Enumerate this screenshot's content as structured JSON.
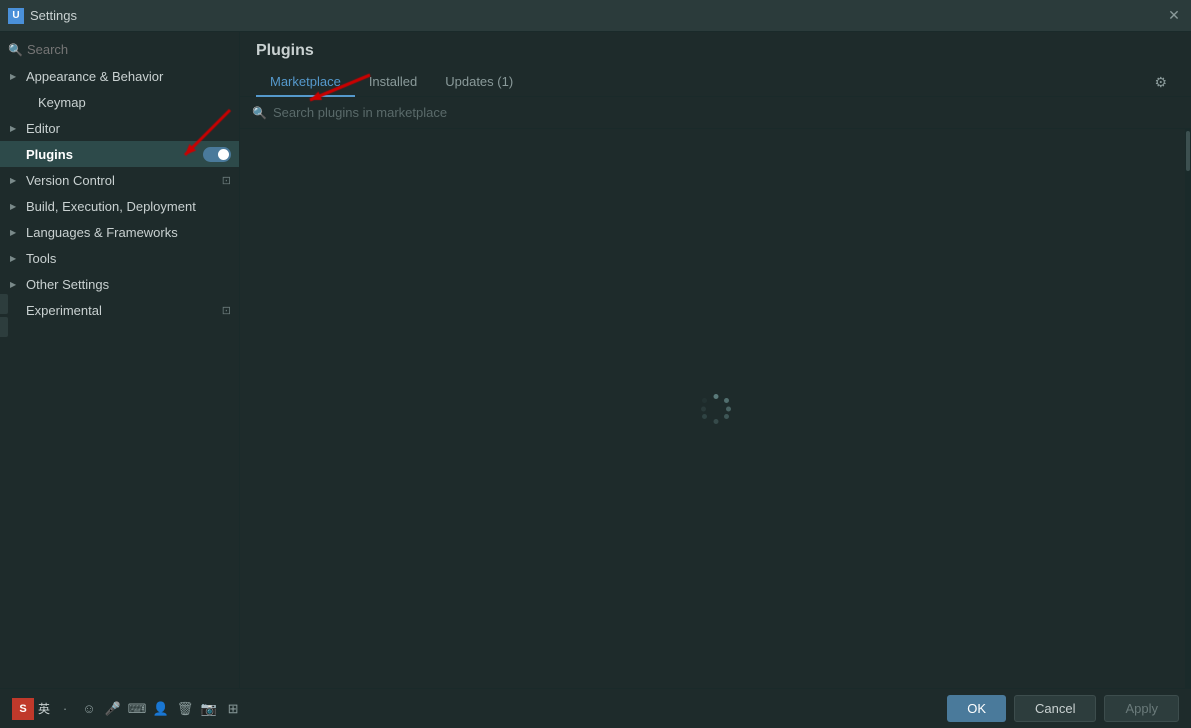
{
  "window": {
    "title": "Settings",
    "close_label": "✕"
  },
  "sidebar": {
    "search_placeholder": "Search",
    "items": [
      {
        "id": "appearance",
        "label": "Appearance & Behavior",
        "has_arrow": true,
        "indent": false,
        "active": false
      },
      {
        "id": "keymap",
        "label": "Keymap",
        "has_arrow": false,
        "indent": true,
        "active": false
      },
      {
        "id": "editor",
        "label": "Editor",
        "has_arrow": true,
        "indent": false,
        "active": false
      },
      {
        "id": "plugins",
        "label": "Plugins",
        "has_arrow": false,
        "indent": false,
        "active": true
      },
      {
        "id": "version-control",
        "label": "Version Control",
        "has_arrow": true,
        "indent": false,
        "active": false
      },
      {
        "id": "build-execution",
        "label": "Build, Execution, Deployment",
        "has_arrow": true,
        "indent": false,
        "active": false
      },
      {
        "id": "languages",
        "label": "Languages & Frameworks",
        "has_arrow": true,
        "indent": false,
        "active": false
      },
      {
        "id": "tools",
        "label": "Tools",
        "has_arrow": true,
        "indent": false,
        "active": false
      },
      {
        "id": "other-settings",
        "label": "Other Settings",
        "has_arrow": true,
        "indent": false,
        "active": false
      },
      {
        "id": "experimental",
        "label": "Experimental",
        "has_arrow": false,
        "indent": false,
        "active": false
      }
    ]
  },
  "plugins_panel": {
    "title": "Plugins",
    "tabs": [
      {
        "id": "marketplace",
        "label": "Marketplace",
        "active": true
      },
      {
        "id": "installed",
        "label": "Installed",
        "active": false
      },
      {
        "id": "updates",
        "label": "Updates (1)",
        "active": false
      }
    ],
    "search_placeholder": "Search plugins in marketplace"
  },
  "bottom_bar": {
    "ok_label": "OK",
    "cancel_label": "Cancel",
    "apply_label": "Apply",
    "taskbar": {
      "ime_label": "S",
      "lang_label": "英",
      "icons": [
        "♪",
        "☺",
        "🎤",
        "⌨",
        "👤",
        "🗑",
        "📷",
        "⊞"
      ]
    }
  }
}
